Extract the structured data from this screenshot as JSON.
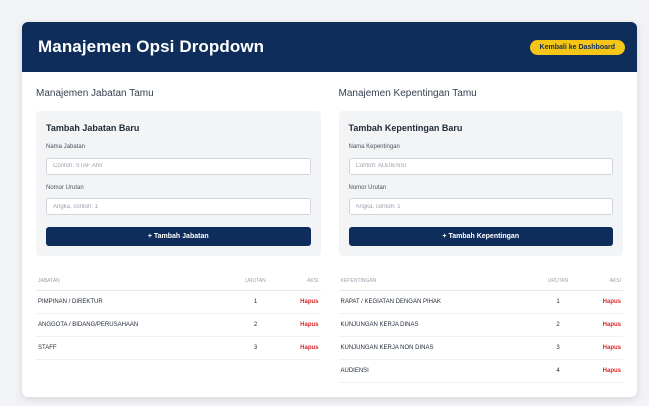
{
  "header": {
    "title": "Manajemen Opsi Dropdown",
    "back_label": "Kembali ke Dashboard"
  },
  "jabatan": {
    "section_title": "Manajemen Jabatan Tamu",
    "form_title": "Tambah Jabatan Baru",
    "name_label": "Nama Jabatan",
    "name_placeholder": "Contoh: STAF Ahli",
    "order_label": "Nomor Urutan",
    "order_placeholder": "Angka, contoh: 1",
    "add_label": "+ Tambah Jabatan",
    "columns": [
      "Jabatan",
      "Urutan",
      "Aksi"
    ],
    "rows": [
      {
        "name": "PIMPINAN / DIREKTUR",
        "order": "1",
        "action": "Hapus"
      },
      {
        "name": "ANGGOTA / BIDANG/PERUSAHAAN",
        "order": "2",
        "action": "Hapus"
      },
      {
        "name": "STAFF",
        "order": "3",
        "action": "Hapus"
      }
    ]
  },
  "kepentingan": {
    "section_title": "Manajemen Kepentingan Tamu",
    "form_title": "Tambah Kepentingan Baru",
    "name_label": "Nama Kepentingan",
    "name_placeholder": "Contoh: AUDIENSI",
    "order_label": "Nomor Urutan",
    "order_placeholder": "Angka, contoh: 1",
    "add_label": "+ Tambah Kepentingan",
    "columns": [
      "Kepentingan",
      "Urutan",
      "Aksi"
    ],
    "rows": [
      {
        "name": "RAPAT / KEGIATAN DENGAN PIHAK",
        "order": "1",
        "action": "Hapus"
      },
      {
        "name": "KUNJUNGAN KERJA DINAS",
        "order": "2",
        "action": "Hapus"
      },
      {
        "name": "KUNJUNGAN KERJA NON DINAS",
        "order": "3",
        "action": "Hapus"
      },
      {
        "name": "AUDIENSI",
        "order": "4",
        "action": "Hapus"
      }
    ]
  }
}
